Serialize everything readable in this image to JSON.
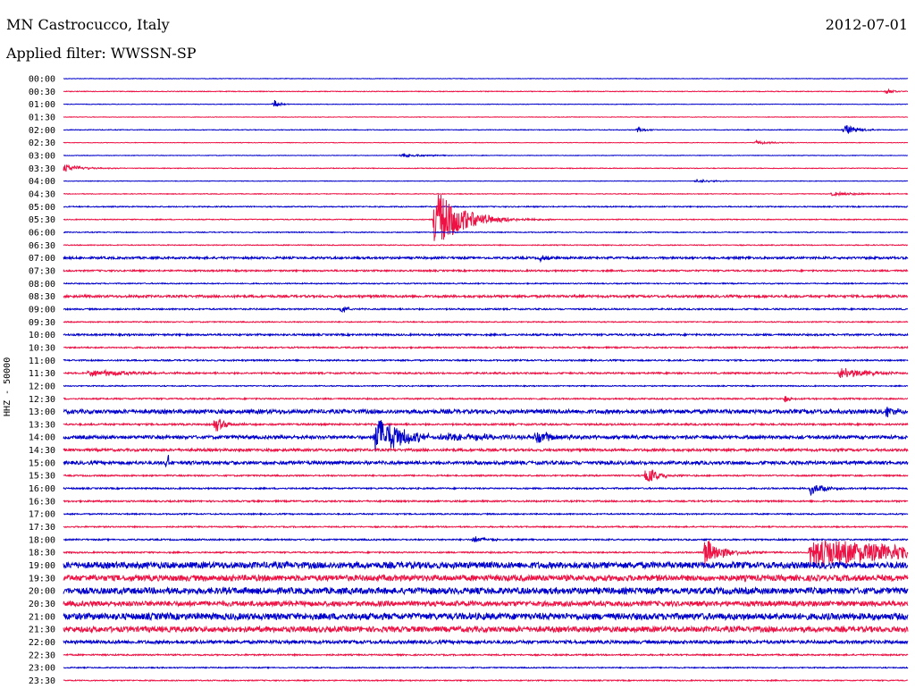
{
  "header": {
    "station": "MN Castrocucco, Italy",
    "date": "2012-07-01",
    "filter": "Applied filter: WWSSN-SP"
  },
  "chart_data": {
    "type": "line",
    "title": "MN Castrocucco, Italy",
    "subtitle": "Applied filter: WWSSN-SP",
    "ylabel": "HHZ - 50000",
    "colors": {
      "even_row": "#0000cc",
      "odd_row": "#ee1144"
    },
    "rows": [
      "00:00",
      "00:30",
      "01:00",
      "01:30",
      "02:00",
      "02:30",
      "03:00",
      "03:30",
      "04:00",
      "04:30",
      "05:00",
      "05:30",
      "06:00",
      "06:30",
      "07:00",
      "07:30",
      "08:00",
      "08:30",
      "09:00",
      "09:30",
      "10:00",
      "10:30",
      "11:00",
      "11:30",
      "12:00",
      "12:30",
      "13:00",
      "13:30",
      "14:00",
      "14:30",
      "15:00",
      "15:30",
      "16:00",
      "16:30",
      "17:00",
      "17:30",
      "18:00",
      "18:30",
      "19:00",
      "19:30",
      "20:00",
      "20:30",
      "21:00",
      "21:30",
      "22:00",
      "22:30",
      "23:00",
      "23:30"
    ],
    "noise_level": [
      0.3,
      0.4,
      0.3,
      0.3,
      0.4,
      0.3,
      0.3,
      0.4,
      0.3,
      0.4,
      0.6,
      0.5,
      0.5,
      0.5,
      1.2,
      0.9,
      0.6,
      1.3,
      0.8,
      0.6,
      1.0,
      0.8,
      0.8,
      0.9,
      0.6,
      0.8,
      2.2,
      1.0,
      1.8,
      1.4,
      1.8,
      0.8,
      0.8,
      0.9,
      0.7,
      0.7,
      0.8,
      0.8,
      3.5,
      3.2,
      3.5,
      2.8,
      3.6,
      3.0,
      1.8,
      0.8,
      0.6,
      0.6
    ],
    "events": [
      {
        "row": 1,
        "pos": 0.975,
        "amp": 3,
        "dur": 0.01
      },
      {
        "row": 2,
        "pos": 0.25,
        "amp": 5,
        "dur": 0.006
      },
      {
        "row": 4,
        "pos": 0.68,
        "amp": 3,
        "dur": 0.01
      },
      {
        "row": 4,
        "pos": 0.925,
        "amp": 6,
        "dur": 0.015
      },
      {
        "row": 5,
        "pos": 0.82,
        "amp": 2,
        "dur": 0.02
      },
      {
        "row": 6,
        "pos": 0.4,
        "amp": 2,
        "dur": 0.03
      },
      {
        "row": 7,
        "pos": 0.0,
        "amp": 5,
        "dur": 0.02
      },
      {
        "row": 8,
        "pos": 0.75,
        "amp": 2,
        "dur": 0.02
      },
      {
        "row": 9,
        "pos": 0.91,
        "amp": 2,
        "dur": 0.04
      },
      {
        "row": 11,
        "pos": 0.44,
        "amp": 36,
        "dur": 0.03
      },
      {
        "row": 14,
        "pos": 0.565,
        "amp": 3,
        "dur": 0.01
      },
      {
        "row": 18,
        "pos": 0.33,
        "amp": 6,
        "dur": 0.006
      },
      {
        "row": 23,
        "pos": 0.03,
        "amp": 4,
        "dur": 0.05
      },
      {
        "row": 23,
        "pos": 0.92,
        "amp": 7,
        "dur": 0.03
      },
      {
        "row": 25,
        "pos": 0.855,
        "amp": 7,
        "dur": 0.004
      },
      {
        "row": 26,
        "pos": 0.975,
        "amp": 6,
        "dur": 0.015
      },
      {
        "row": 27,
        "pos": 0.18,
        "amp": 9,
        "dur": 0.012
      },
      {
        "row": 28,
        "pos": 0.37,
        "amp": 24,
        "dur": 0.03
      },
      {
        "row": 28,
        "pos": 0.45,
        "amp": 4,
        "dur": 0.1
      },
      {
        "row": 28,
        "pos": 0.56,
        "amp": 7,
        "dur": 0.02
      },
      {
        "row": 30,
        "pos": 0.123,
        "amp": 16,
        "dur": 0.002
      },
      {
        "row": 31,
        "pos": 0.69,
        "amp": 10,
        "dur": 0.015
      },
      {
        "row": 32,
        "pos": 0.885,
        "amp": 7,
        "dur": 0.015
      },
      {
        "row": 36,
        "pos": 0.485,
        "amp": 4,
        "dur": 0.015
      },
      {
        "row": 37,
        "pos": 0.76,
        "amp": 16,
        "dur": 0.02
      },
      {
        "row": 37,
        "pos": 0.885,
        "amp": 18,
        "dur": 0.12
      }
    ]
  }
}
